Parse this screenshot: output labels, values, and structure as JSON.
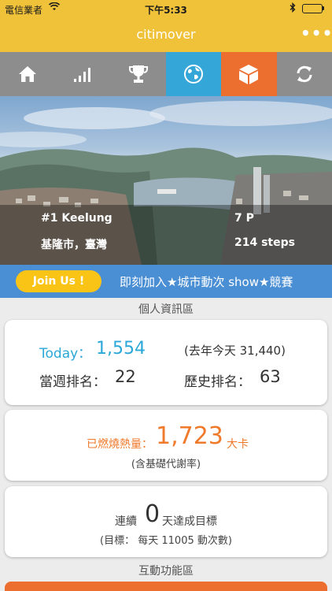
{
  "status_bar": {
    "carrier": "電信業者",
    "time": "下午5:33"
  },
  "header": {
    "title": "citimover",
    "more": "•••"
  },
  "tabs": [
    {
      "name": "home",
      "icon": "home-icon"
    },
    {
      "name": "stats",
      "icon": "bar-chart-icon"
    },
    {
      "name": "trophy",
      "icon": "trophy-icon"
    },
    {
      "name": "globe",
      "icon": "globe-icon",
      "active_color": "#35a6d8"
    },
    {
      "name": "box",
      "icon": "cube-icon",
      "active_color": "#ec6f2f"
    },
    {
      "name": "sync",
      "icon": "refresh-icon"
    }
  ],
  "hero": {
    "rank": "#1 Keelung",
    "points": "7 P",
    "location": "基隆市，臺灣",
    "steps": "214 steps"
  },
  "join": {
    "button": "Join Us !",
    "text": "即刻加入★城市動次 show★競賽"
  },
  "profile": {
    "section": "個人資訊區",
    "today_label": "Today：",
    "today_value": "1,554",
    "last_year": "(去年今天 31,440)",
    "week_rank_label": "當週排名：",
    "week_rank": "22",
    "history_rank_label": "歷史排名：",
    "history_rank": "63"
  },
  "calories": {
    "label": "已燃燒熱量：",
    "value": "1,723",
    "unit": "大卡",
    "note": "(含基礎代謝率)"
  },
  "goal": {
    "prefix": "連續",
    "days": "0",
    "suffix": "天達成目標",
    "target": "(目標： 每天 11005 動次數)"
  },
  "interactive": {
    "section": "互動功能區"
  },
  "colors": {
    "brand_yellow": "#f0c23a",
    "accent_blue": "#2ba8d8",
    "accent_orange": "#ef7a2c",
    "banner_blue": "#4a8ed4"
  }
}
